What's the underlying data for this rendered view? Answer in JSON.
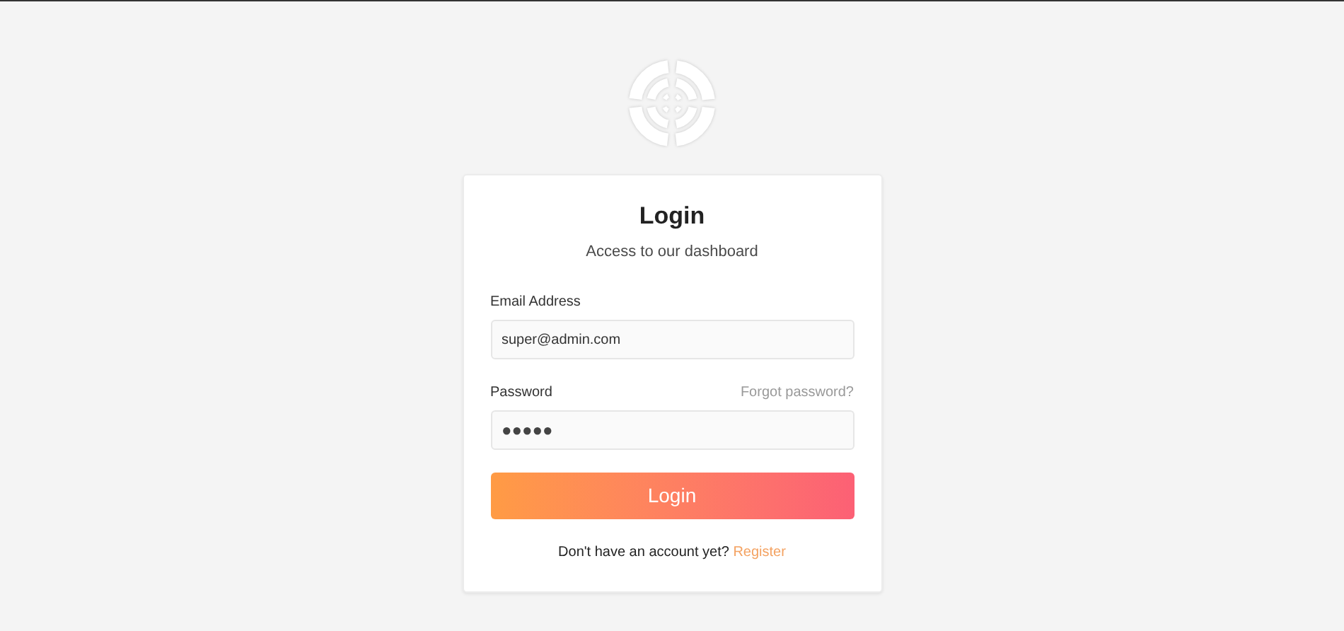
{
  "card": {
    "title": "Login",
    "subtitle": "Access to our dashboard"
  },
  "email": {
    "label": "Email Address",
    "value": "super@admin.com"
  },
  "password": {
    "label": "Password",
    "forgot_link": "Forgot password?",
    "value": "●●●●●"
  },
  "login_button": "Login",
  "register": {
    "text": "Don't have an account yet?",
    "link": "Register"
  }
}
